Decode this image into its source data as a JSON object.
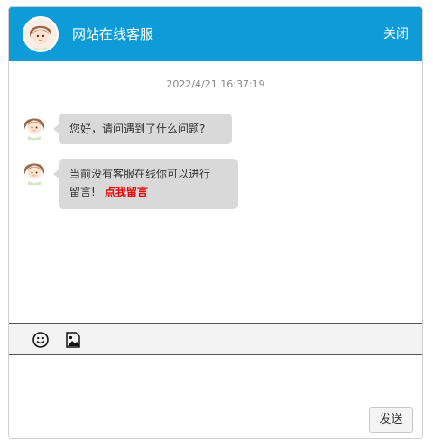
{
  "header": {
    "title": "网站在线客服",
    "close_label": "关闭"
  },
  "messages": {
    "timestamp": "2022/4/21 16:37:19",
    "items": [
      {
        "sender": "agent",
        "text": "您好，请问遇到了什么问题?"
      },
      {
        "sender": "agent",
        "text_line1": "当前没有客服在线你可以进行",
        "text_line2": "留言!",
        "link_label": "点我留言"
      }
    ]
  },
  "toolbar": {
    "tools": [
      {
        "icon": "smiley-icon",
        "label": "emoji"
      },
      {
        "icon": "image-icon",
        "label": "image"
      }
    ]
  },
  "composer": {
    "input_value": "",
    "send_label": "发送"
  },
  "colors": {
    "header_bg": "#0e9bd8",
    "bubble_bg": "#d9d9d9",
    "link_red": "#ee0000",
    "toolbar_bg": "#f3f3f3"
  }
}
